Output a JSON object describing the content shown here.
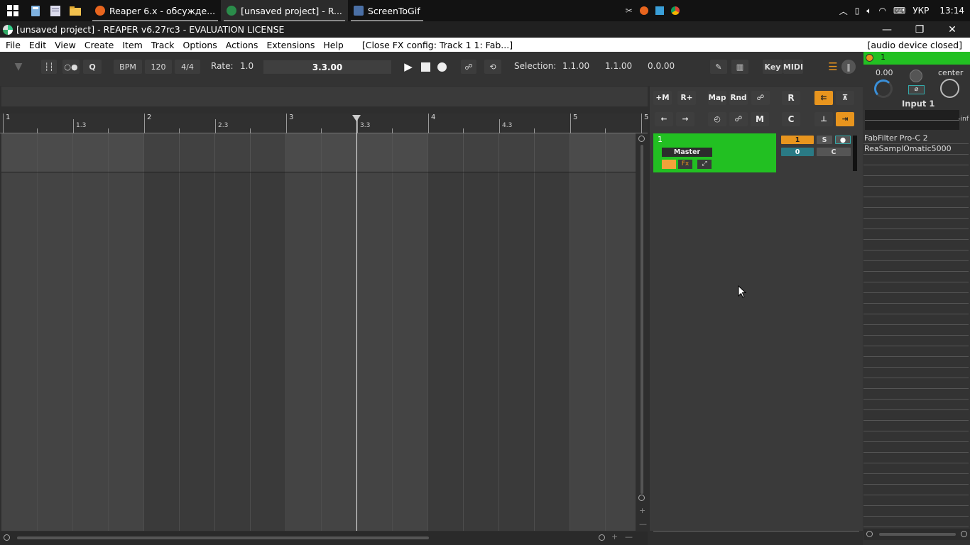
{
  "taskbar": {
    "tasks": [
      {
        "label": "Reaper 6.x - обсужде...",
        "color": "#e8651e"
      },
      {
        "label": "[unsaved project] - R...",
        "color": "#2a8c4a"
      },
      {
        "label": "ScreenToGif",
        "color": "#4a6fa5"
      }
    ],
    "lang": "УКР",
    "time": "13:14"
  },
  "titlebar": {
    "title": "[unsaved project] - REAPER v6.27rc3 - EVALUATION LICENSE"
  },
  "menu": {
    "items": [
      "File",
      "Edit",
      "View",
      "Create",
      "Item",
      "Track",
      "Options",
      "Actions",
      "Extensions",
      "Help"
    ],
    "extra": "[Close FX config: Track 1 1: Fab...]",
    "right": "[audio device closed]"
  },
  "transport": {
    "q": "Q",
    "bpm_label": "BPM",
    "bpm": "120",
    "timesig": "4/4",
    "rate_label": "Rate:",
    "rate": "1.0",
    "position": "3.3.00",
    "selection_label": "Selection:",
    "sel_start": "1.1.00",
    "sel_end": "1.1.00",
    "sel_len": "0.0.00",
    "key": "Key",
    "midi": "MIDI"
  },
  "ruler": {
    "bars": [
      "1",
      "2",
      "3",
      "4",
      "5"
    ],
    "halves": [
      "1.3",
      "2.3",
      "3.3",
      "4.3"
    ],
    "last": "5"
  },
  "panel": {
    "row1": [
      "+M",
      "R+",
      "Map",
      "Rnd",
      "R"
    ],
    "row2": [
      "M",
      "C"
    ]
  },
  "track": {
    "number": "1",
    "name": "Master",
    "fx": "Fx",
    "rec_input": "1",
    "solo": "S",
    "pan": "0",
    "c": "C"
  },
  "mixer": {
    "number": "1",
    "volume": "0.00",
    "pan": "center",
    "input": "Input 1",
    "meter": "-inf",
    "fx": [
      "FabFilter Pro-C 2",
      "ReaSamplOmatic5000"
    ]
  }
}
